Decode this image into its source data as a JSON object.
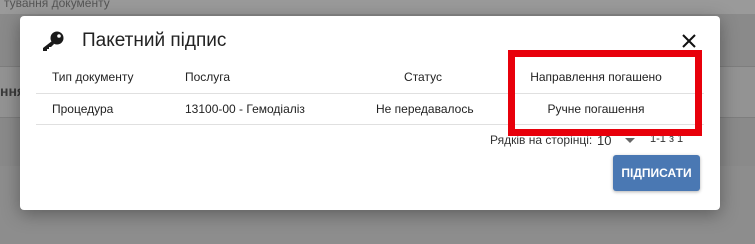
{
  "background": {
    "top_text": "тування документу",
    "band_text": "ння"
  },
  "dialog": {
    "title": "Пакетний підпис",
    "icon": "key-icon",
    "close_icon": "close-icon"
  },
  "table": {
    "columns": [
      "Тип документу",
      "Послуга",
      "Статус",
      "Направлення погашено"
    ],
    "rows": [
      [
        "Процедура",
        "13100-00 - Гемодіаліз",
        "Не передавалось",
        "Ручне погашення"
      ]
    ]
  },
  "pagination": {
    "rows_per_page_label": "Рядків на сторінці:",
    "rows_per_page_value": "10",
    "range": "1-1 з 1"
  },
  "actions": {
    "sign_label": "ПІДПИСАТИ"
  },
  "colors": {
    "primary": "#4a78b3",
    "highlight": "#e8000b"
  }
}
